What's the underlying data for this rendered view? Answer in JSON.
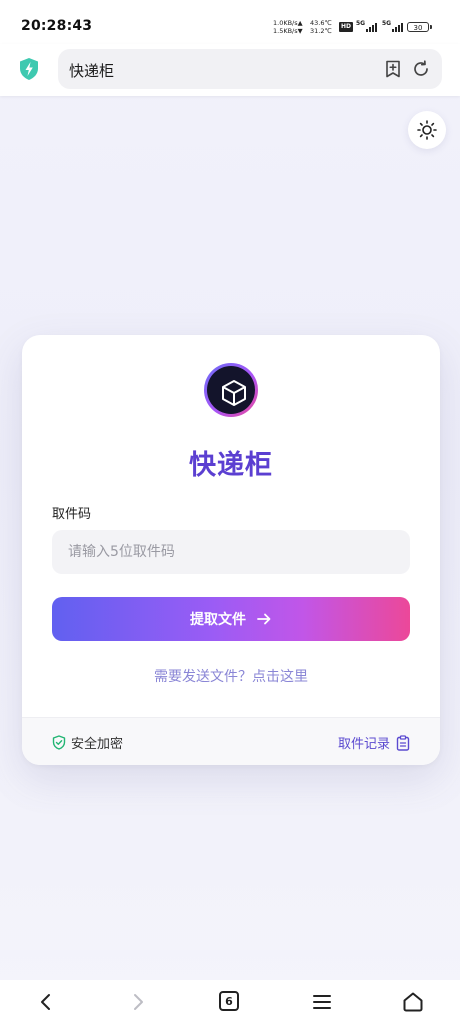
{
  "status_bar": {
    "time": "20:28:43",
    "net_up": "1.0KB/s▲",
    "net_down": "1.5KB/s▼",
    "temp_1": "43.6℃",
    "temp_2": "31.2℃",
    "hd": "HD",
    "sim1": "5G",
    "sim2": "5G",
    "battery": "30"
  },
  "browser": {
    "url_title": "快递柜",
    "tab_count": "6"
  },
  "card": {
    "title": "快递柜",
    "code_label": "取件码",
    "code_placeholder": "请输入5位取件码",
    "code_value": "",
    "submit_label": "提取文件",
    "send_link": "需要发送文件？点击这里",
    "secure_label": "安全加密",
    "records_label": "取件记录"
  },
  "colors": {
    "accent": "#5b3fd1",
    "gradient_start": "#6160f0",
    "gradient_end": "#ec4899",
    "link": "#8a86d6"
  },
  "icons": {
    "browser_shield": "shield-bolt-icon",
    "bookmark": "bookmark-add-icon",
    "refresh": "refresh-icon",
    "theme": "sun-icon",
    "logo": "box-icon",
    "submit": "arrow-right-icon",
    "secure": "shield-check-icon",
    "records": "clipboard-icon",
    "back": "chevron-left-icon",
    "forward": "chevron-right-icon",
    "menu": "menu-icon",
    "home": "home-icon"
  }
}
